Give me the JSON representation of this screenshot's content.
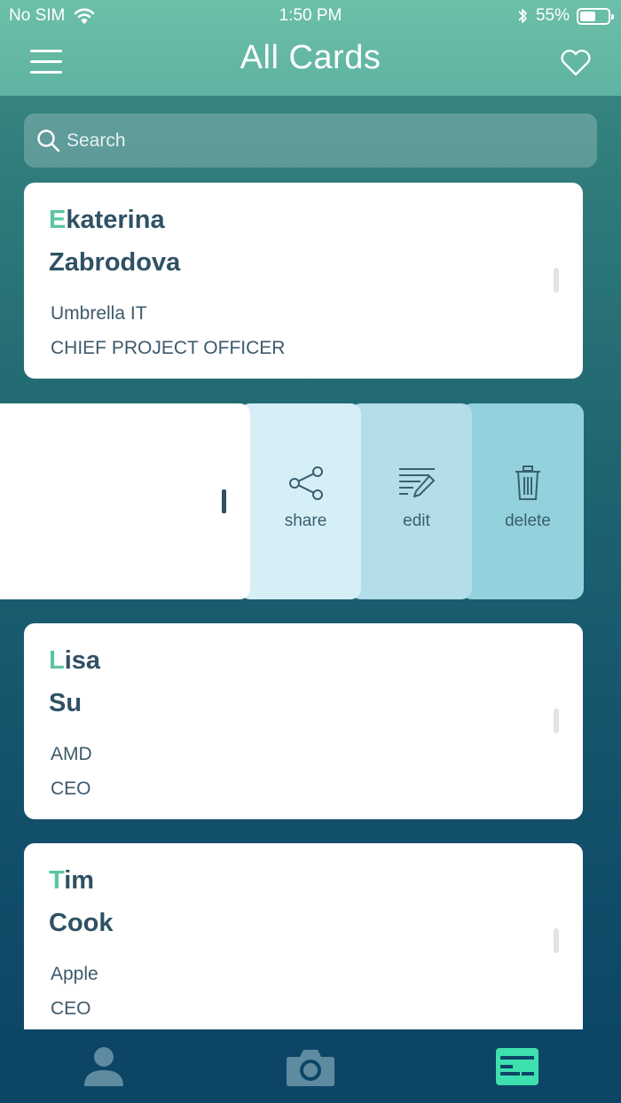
{
  "status_bar": {
    "carrier": "No SIM",
    "time": "1:50 PM",
    "battery": "55%",
    "battery_level": 0.55,
    "icons": [
      "wifi-icon",
      "bluetooth-icon",
      "battery-icon"
    ]
  },
  "nav": {
    "title": "All Cards",
    "left_icon": "hamburger-menu-icon",
    "right_icon": "heart-icon"
  },
  "search": {
    "placeholder": "Search",
    "icon": "search-icon"
  },
  "cards": [
    {
      "first_initial": "E",
      "first_rest": "katerina",
      "last": "Zabrodova",
      "company": "Umbrella IT",
      "role": "CHIEF PROJECT OFFICER"
    },
    {
      "first_initial": "L",
      "first_rest": "isa",
      "last": "Su",
      "company": "AMD",
      "role": "CEO"
    },
    {
      "first_initial": "T",
      "first_rest": "im",
      "last": "Cook",
      "company": "Apple",
      "role": "CEO"
    }
  ],
  "swipe_actions": {
    "share": "share",
    "edit": "edit",
    "delete": "delete"
  },
  "tabbar": {
    "tabs": [
      {
        "icon": "person-icon",
        "active": false
      },
      {
        "icon": "camera-icon",
        "active": false
      },
      {
        "icon": "cards-icon",
        "active": true
      }
    ]
  },
  "colors": {
    "accent": "#5cc4a4",
    "header": "#5eb3a2",
    "tab_active": "#3ee0ae",
    "tab_inactive": "#5f8ba0",
    "name_text": "#2f5164"
  }
}
